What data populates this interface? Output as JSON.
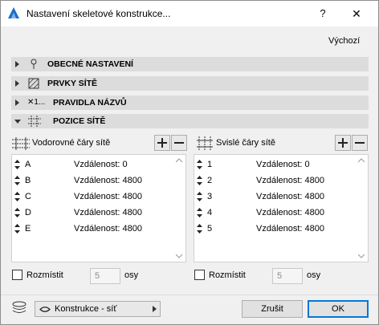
{
  "window": {
    "title": "Nastavení skeletové konstrukce...",
    "help_label": "?",
    "close_label": "✕"
  },
  "default_link": "Výchozí",
  "sections": [
    {
      "label": "OBECNÉ NASTAVENÍ",
      "icon": "pin-icon",
      "expanded": false
    },
    {
      "label": "PRVKY SÍTĚ",
      "icon": "grid-element-icon",
      "expanded": false
    },
    {
      "label": "PRAVIDLA NÁZVŮ",
      "icon": "naming-icon",
      "expanded": false,
      "icon_text": "✕1..."
    },
    {
      "label": "POZICE SÍTĚ",
      "icon": "grid-position-icon",
      "expanded": true
    }
  ],
  "horizontal": {
    "header": "Vodorovné čáry sítě",
    "rows": [
      {
        "name": "A",
        "distance": "Vzdálenost: 0"
      },
      {
        "name": "B",
        "distance": "Vzdálenost: 4800"
      },
      {
        "name": "C",
        "distance": "Vzdálenost: 4800"
      },
      {
        "name": "D",
        "distance": "Vzdálenost: 4800"
      },
      {
        "name": "E",
        "distance": "Vzdálenost: 4800"
      }
    ],
    "distribute_label": "Rozmístit",
    "count_value": "5",
    "axes_label": "osy"
  },
  "vertical": {
    "header": "Svislé čáry sítě",
    "rows": [
      {
        "name": "1",
        "distance": "Vzdálenost: 0"
      },
      {
        "name": "2",
        "distance": "Vzdálenost: 4800"
      },
      {
        "name": "3",
        "distance": "Vzdálenost: 4800"
      },
      {
        "name": "4",
        "distance": "Vzdálenost: 4800"
      },
      {
        "name": "5",
        "distance": "Vzdálenost: 4800"
      }
    ],
    "distribute_label": "Rozmístit",
    "count_value": "5",
    "axes_label": "osy"
  },
  "footer": {
    "layer_dropdown": "Konstrukce - síť",
    "cancel_label": "Zrušit",
    "ok_label": "OK"
  },
  "colors": {
    "section_bg": "#dcdcdc",
    "ok_border": "#0078d7",
    "archicad_blue": "#1a6fc9"
  }
}
